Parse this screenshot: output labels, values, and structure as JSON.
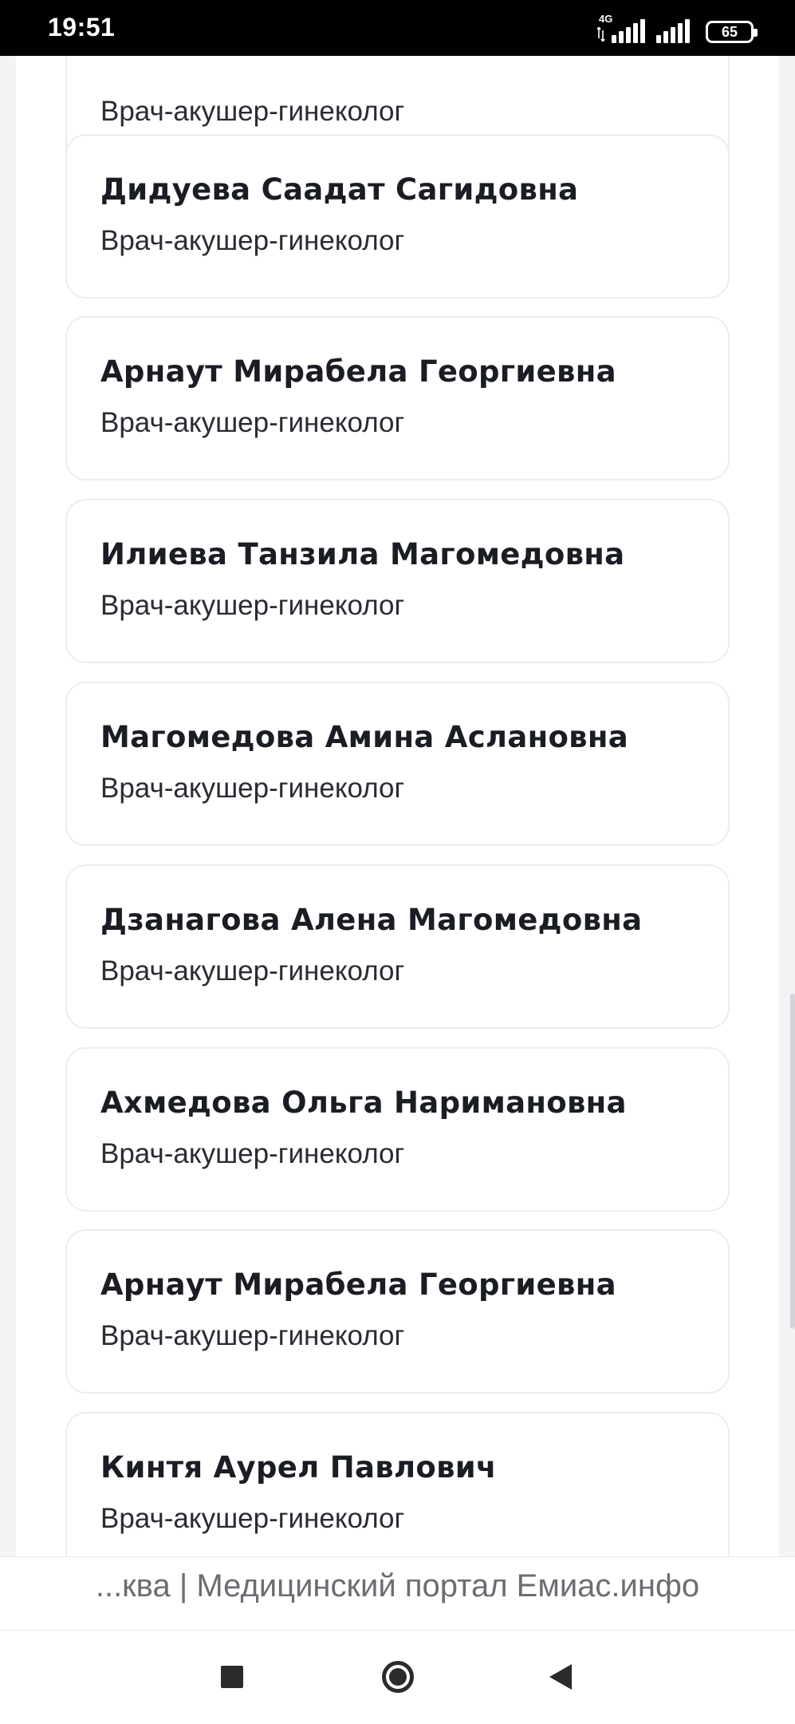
{
  "status_bar": {
    "time": "19:51",
    "network_type": "4G",
    "battery_level": "65",
    "icons": [
      "mobile-data-icon",
      "signal-icon",
      "signal-icon",
      "battery-icon"
    ]
  },
  "doctor_list": {
    "items": [
      {
        "name": "",
        "specialty": "Врач-акушер-гинеколог"
      },
      {
        "name": "Дидуева Саадат Сагидовна",
        "specialty": "Врач-акушер-гинеколог"
      },
      {
        "name": "Арнаут Мирабела Георгиевна",
        "specialty": "Врач-акушер-гинеколог"
      },
      {
        "name": "Илиева Танзила Магомедовна",
        "specialty": "Врач-акушер-гинеколог"
      },
      {
        "name": "Магомедова Амина Аслановна",
        "specialty": "Врач-акушер-гинеколог"
      },
      {
        "name": "Дзанагова Алена Магомедовна",
        "specialty": "Врач-акушер-гинеколог"
      },
      {
        "name": "Ахмедова Ольга Наримановна",
        "specialty": "Врач-акушер-гинеколог"
      },
      {
        "name": "Арнаут Мирабела Георгиевна",
        "specialty": "Врач-акушер-гинеколог"
      },
      {
        "name": "Кинтя Аурел Павлович",
        "specialty": "Врач-акушер-гинеколог"
      }
    ]
  },
  "page_title": "...ква | Медицинский портал Емиас.инфо",
  "navigation": {
    "icons": [
      "recent-apps-icon",
      "home-icon",
      "back-icon"
    ]
  },
  "colors": {
    "status_bar_bg": "#000000",
    "card_border": "#ececf1",
    "name_text": "#1b1d24",
    "title_text": "#6b6d72"
  }
}
